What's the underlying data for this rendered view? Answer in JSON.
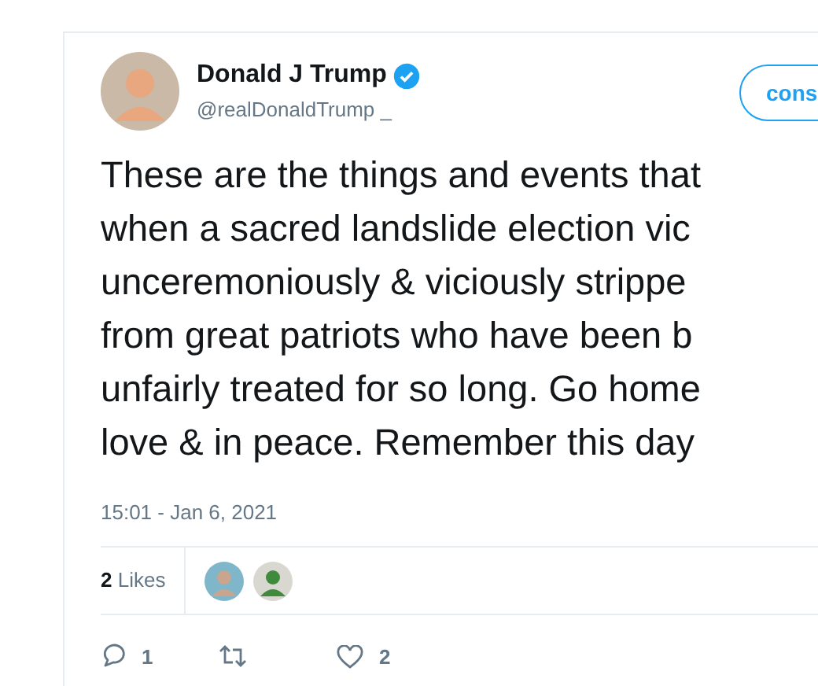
{
  "author": {
    "name": "Donald J Trump",
    "verified": true,
    "handle": "@realDonaldTrump _"
  },
  "action_button": {
    "label": "cons"
  },
  "tweet_lines": [
    "These are the things and events that",
    "when a sacred landslide election vic",
    "unceremoniously & viciously strippe",
    "from great patriots who have been b",
    "unfairly treated for so long. Go home",
    "love & in peace. Remember this day"
  ],
  "timestamp": "15:01 - Jan 6, 2021",
  "likes": {
    "count": "2",
    "label": "Likes"
  },
  "actions": [
    {
      "kind": "reply",
      "count": "1"
    },
    {
      "kind": "retweet"
    },
    {
      "kind": "like",
      "count": "2"
    }
  ]
}
